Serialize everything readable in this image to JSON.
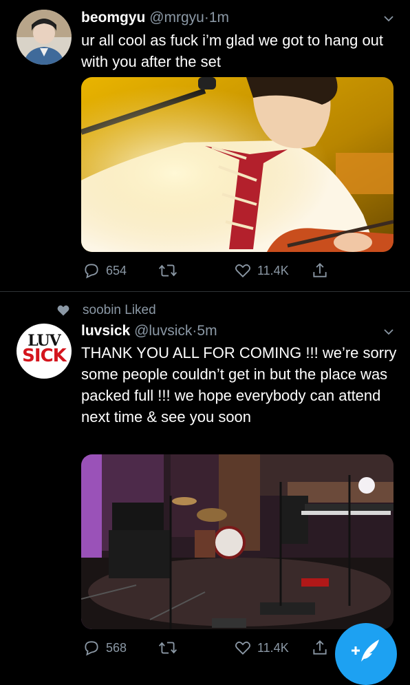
{
  "tweets": [
    {
      "name": "beomgyu",
      "handle": "@mrgyu",
      "separator": "·",
      "time": "1m",
      "text": "ur all cool as fuck i’m glad we got to hang out with you after the set",
      "replies": "654",
      "retweets": "",
      "likes": "11.4K"
    },
    {
      "social_context": "soobin Liked",
      "name": "luvsick",
      "handle": "@luvsick",
      "separator": "·",
      "time": "5m",
      "avatar_text": [
        "LUV",
        "SICK"
      ],
      "text": "THANK YOU ALL FOR COMING !!! we’re sorry some people couldn’t get in but the place was packed full !!! we hope everybody can attend next time & see you soon",
      "replies": "568",
      "retweets": "",
      "likes": "11.4K"
    }
  ],
  "compose_button": {
    "icon": "compose-icon"
  },
  "colors": {
    "background": "#000000",
    "secondary_text": "#8b98a5",
    "accent": "#1da1f2",
    "divider": "#2f3336"
  }
}
